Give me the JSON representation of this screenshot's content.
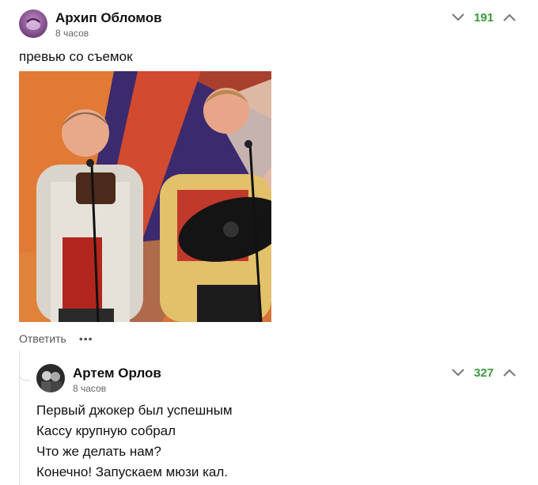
{
  "comments": [
    {
      "author": "Архип Обломов",
      "time": "8 часов",
      "score": "191",
      "text": "превью со съемок",
      "actions": {
        "reply": "Ответить",
        "more": "•••"
      }
    },
    {
      "author": "Артем Орлов",
      "time": "8 часов",
      "score": "327",
      "lines": [
        "Первый джокер был успешным",
        "Кассу крупную собрал",
        "Что же делать нам?",
        "Конечно! Запускаем мюзи кал."
      ]
    }
  ],
  "colors": {
    "score": "#3a9a3a",
    "accent_red": "#c8362a",
    "stage_blue": "#2c3a8f"
  }
}
